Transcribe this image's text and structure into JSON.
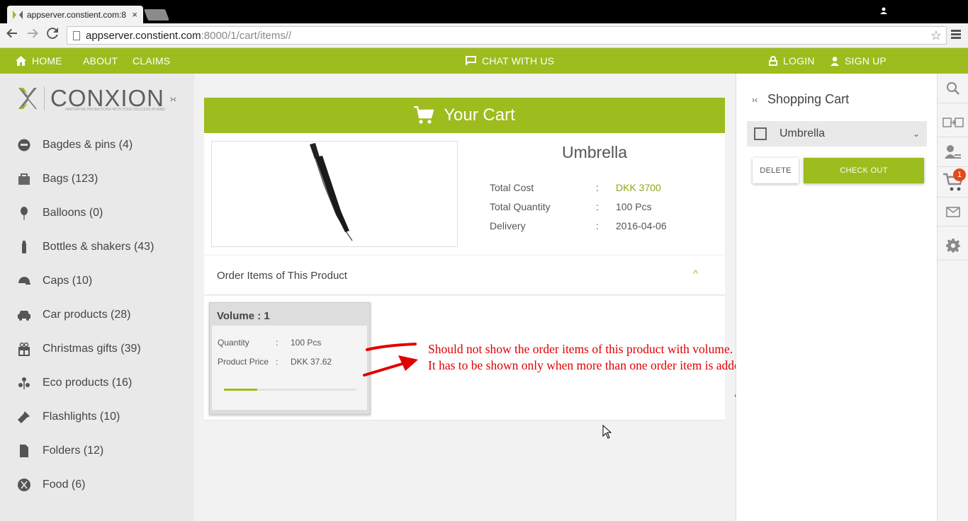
{
  "browser": {
    "tab_title": "appserver.constient.com:8",
    "tab_close": "×",
    "url_host": "appserver.constient.com",
    "url_path": ":8000/1/cart/items//"
  },
  "header": {
    "home": "HOME",
    "about": "ABOUT",
    "claims": "CLAIMS",
    "chat": "CHAT WITH US",
    "login": "LOGIN",
    "signup": "SIGN UP",
    "accent_color": "#9dbc1d"
  },
  "sidebar": {
    "logo_text": "CONXION",
    "logo_tagline": "INNOVATIVE PROMOTIONS WITH YOUR SUCCESS IN MIND",
    "collapse_glyph": "›‹",
    "categories": [
      {
        "label": "Bagdes & pins (4)",
        "icon": "badge-icon"
      },
      {
        "label": "Bags (123)",
        "icon": "bag-icon"
      },
      {
        "label": "Balloons (0)",
        "icon": "balloon-icon"
      },
      {
        "label": "Bottles & shakers (43)",
        "icon": "bottle-icon"
      },
      {
        "label": "Caps (10)",
        "icon": "cap-icon"
      },
      {
        "label": "Car products (28)",
        "icon": "car-icon"
      },
      {
        "label": "Christmas gifts (39)",
        "icon": "gift-icon"
      },
      {
        "label": "Eco products (16)",
        "icon": "eco-icon"
      },
      {
        "label": "Flashlights (10)",
        "icon": "flashlight-icon"
      },
      {
        "label": "Folders (12)",
        "icon": "folder-icon"
      },
      {
        "label": "Food (6)",
        "icon": "food-icon"
      }
    ]
  },
  "main": {
    "cart_title": "Your Cart",
    "product": {
      "name": "Umbrella",
      "rows": [
        {
          "label": "Total Cost",
          "sep": ":",
          "value": "DKK 3700"
        },
        {
          "label": "Total Quantity",
          "sep": ":",
          "value": "100 Pcs"
        },
        {
          "label": "Delivery",
          "sep": ":",
          "value": "2016-04-06"
        }
      ]
    },
    "order_items_title": "Order Items of This Product",
    "order_items_toggle": "^",
    "volume": {
      "title": "Volume   : 1",
      "rows": [
        {
          "label": "Quantity",
          "sep": ":",
          "value": "100 Pcs"
        },
        {
          "label": "Product Price",
          "sep": ":",
          "value": "DKK 37.62"
        }
      ],
      "progress": 0.25
    },
    "annotation_line1": "Should not show the order items of this product with volume.",
    "annotation_line2": "It has to be shown only when more than one order item is added."
  },
  "cart_panel": {
    "collapse_glyph": "›‹",
    "title": "Shopping Cart",
    "item_name": "Umbrella",
    "item_dropdown": "⌄",
    "delete_label": "DELETE",
    "checkout_label": "CHECK OUT"
  },
  "rail": {
    "cart_badge": "1",
    "icons": [
      "search-icon",
      "compare-icon",
      "user-admin-icon",
      "cart-icon",
      "mail-icon",
      "settings-icon"
    ]
  }
}
